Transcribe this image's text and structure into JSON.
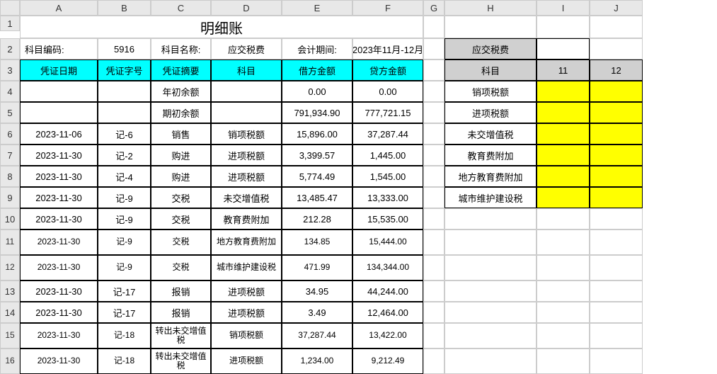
{
  "cols": [
    "A",
    "B",
    "C",
    "D",
    "E",
    "F",
    "G",
    "H",
    "I",
    "J"
  ],
  "rows": [
    "1",
    "2",
    "3",
    "4",
    "5",
    "6",
    "7",
    "8",
    "9",
    "10",
    "11",
    "12",
    "13",
    "14",
    "15",
    "16"
  ],
  "title": "明细账",
  "meta": {
    "codeLabel": "科目编码:",
    "code": "5916",
    "nameLabel": "科目名称:",
    "name": "应交税费",
    "periodLabel": "会计期间:",
    "period": "2023年11月-12月"
  },
  "headers": {
    "date": "凭证日期",
    "vno": "凭证字号",
    "summary": "凭证摘要",
    "subject": "科目",
    "debit": "借方金额",
    "credit": "贷方金额"
  },
  "data": [
    {
      "date": "",
      "vno": "",
      "summary": "年初余额",
      "subject": "",
      "debit": "0.00",
      "credit": "0.00"
    },
    {
      "date": "",
      "vno": "",
      "summary": "期初余额",
      "subject": "",
      "debit": "791,934.90",
      "credit": "777,721.15"
    },
    {
      "date": "2023-11-06",
      "vno": "记-6",
      "summary": "销售",
      "subject": "销项税额",
      "debit": "15,896.00",
      "credit": "37,287.44"
    },
    {
      "date": "2023-11-30",
      "vno": "记-2",
      "summary": "购进",
      "subject": "进项税额",
      "debit": "3,399.57",
      "credit": "1,445.00"
    },
    {
      "date": "2023-11-30",
      "vno": "记-4",
      "summary": "购进",
      "subject": "进项税额",
      "debit": "5,774.49",
      "credit": "1,545.00"
    },
    {
      "date": "2023-11-30",
      "vno": "记-9",
      "summary": "交税",
      "subject": "未交增值税",
      "debit": "13,485.47",
      "credit": "13,333.00"
    },
    {
      "date": "2023-11-30",
      "vno": "记-9",
      "summary": "交税",
      "subject": "教育费附加",
      "debit": "212.28",
      "credit": "15,535.00"
    },
    {
      "date": "2023-11-30",
      "vno": "记-9",
      "summary": "交税",
      "subject": "地方教育费附加",
      "debit": "134.85",
      "credit": "15,444.00"
    },
    {
      "date": "2023-11-30",
      "vno": "记-9",
      "summary": "交税",
      "subject": "城市维护建设税",
      "debit": "471.99",
      "credit": "134,344.00"
    },
    {
      "date": "2023-11-30",
      "vno": "记-17",
      "summary": "报销",
      "subject": "进项税额",
      "debit": "34.95",
      "credit": "44,244.00"
    },
    {
      "date": "2023-11-30",
      "vno": "记-17",
      "summary": "报销",
      "subject": "进项税额",
      "debit": "3.49",
      "credit": "12,464.00"
    },
    {
      "date": "2023-11-30",
      "vno": "记-18",
      "summary": "转出未交增值税",
      "subject": "销项税额",
      "debit": "37,287.44",
      "credit": "13,422.00"
    },
    {
      "date": "2023-11-30",
      "vno": "记-18",
      "summary": "转出未交增值税",
      "subject": "进项税额",
      "debit": "1,234.00",
      "credit": "9,212.49"
    }
  ],
  "side": {
    "title": "应交税费",
    "subjectHdr": "科目",
    "m1": "11",
    "m2": "12",
    "items": [
      "销项税额",
      "进项税额",
      "未交增值税",
      "教育费附加",
      "地方教育费附加",
      "城市维护建设税"
    ]
  }
}
